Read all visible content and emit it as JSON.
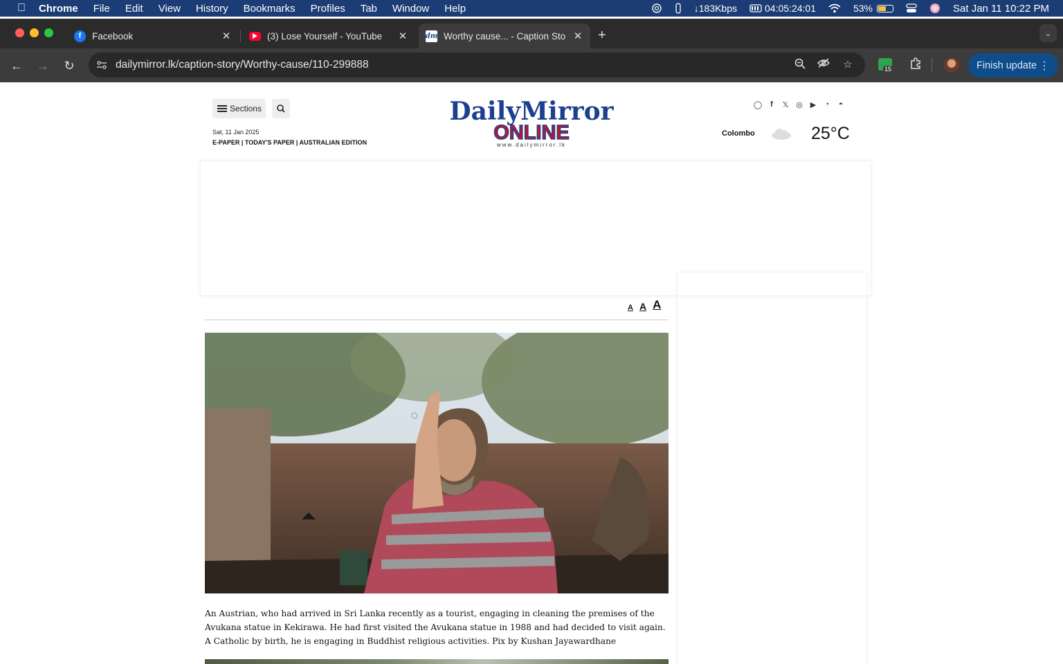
{
  "menubar": {
    "app_name": "Chrome",
    "items": [
      "File",
      "Edit",
      "View",
      "History",
      "Bookmarks",
      "Profiles",
      "Tab",
      "Window",
      "Help"
    ],
    "network_speed": "↓183Kbps",
    "battery_time": "04:05:24:01",
    "battery_percent": "53%",
    "battery_level": 0.53,
    "datetime": "Sat Jan 11  10:22 PM"
  },
  "tabs": [
    {
      "title": "Facebook",
      "icon": "facebook-icon",
      "active": false
    },
    {
      "title": "(3) Lose Yourself - YouTube",
      "icon": "youtube-icon",
      "active": false
    },
    {
      "title": "Worthy cause... - Caption Sto",
      "icon": "dailymirror-favicon",
      "active": true
    }
  ],
  "toolbar": {
    "url": "dailymirror.lk/caption-story/Worthy-cause/110-299888",
    "extension_badge": "15",
    "update_label": "Finish update"
  },
  "site": {
    "sections_label": "Sections",
    "date": "Sat, 11 Jan 2025",
    "editions": "E-PAPER | TODAY'S PAPER | AUSTRALIAN EDITION",
    "logo_top": "DailyMirror",
    "logo_bottom": "ONLINE",
    "logo_url": "www.dailymirror.lk",
    "social_icons": [
      "whatsapp-icon",
      "facebook-icon",
      "x-icon",
      "instagram-icon",
      "youtube-icon",
      "rss-icon",
      "android-icon"
    ],
    "weather_city": "Colombo",
    "temperature": "25°C",
    "font_sizes": [
      "A",
      "A",
      "A"
    ]
  },
  "article": {
    "caption": "An Austrian, who had arrived in Sri Lanka recently as a tourist, engaging in cleaning the premises of the Avukana statue in Kekirawa. He had first visited the Avukana statue in 1988 and had decided to visit again. A Catholic by birth, he is engaging in Buddhist religious activities. Pix by Kushan Jayawardhane"
  },
  "colors": {
    "menubar": "#1b3c74",
    "tabstrip": "#2b2b2b",
    "toolbar": "#3c3c3c",
    "update_button": "#0f4c8a",
    "logo_blue": "#1c3f8f",
    "logo_red": "#d0141c"
  }
}
